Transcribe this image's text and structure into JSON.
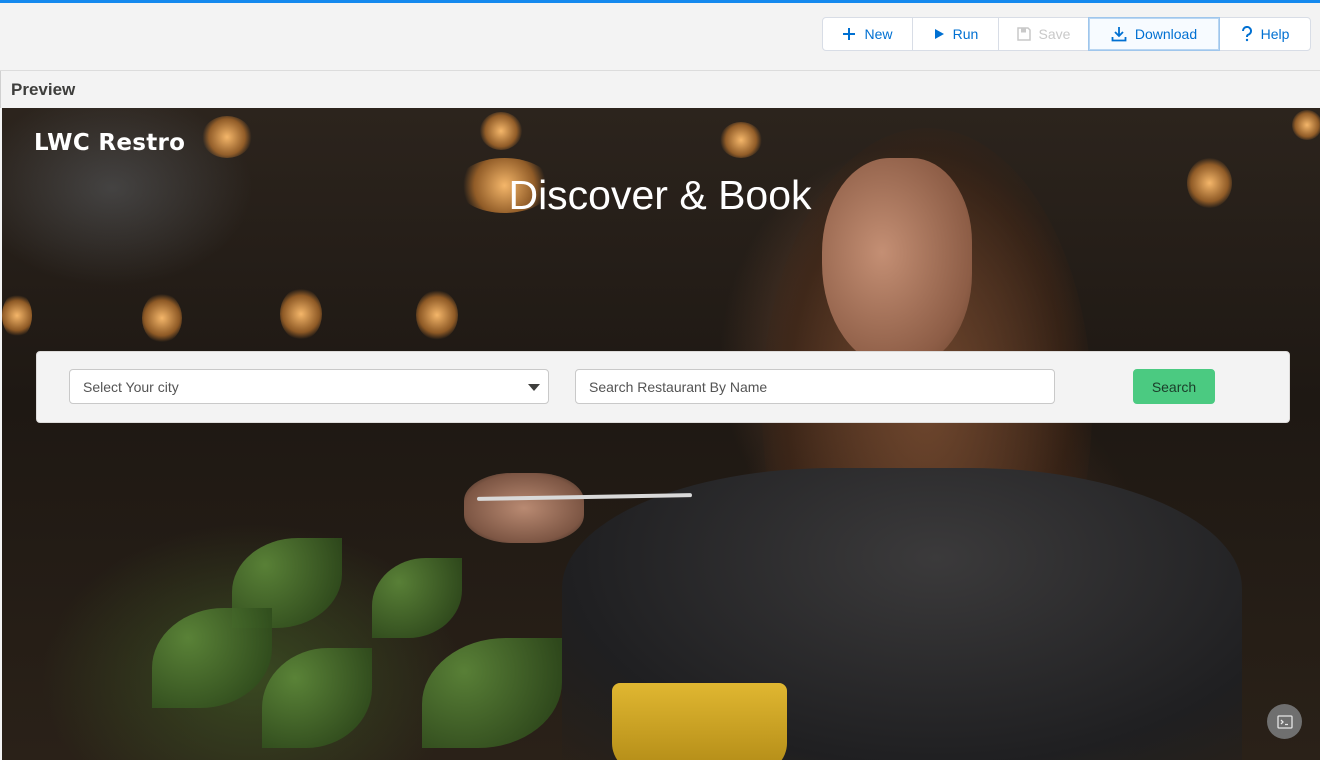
{
  "toolbar": {
    "buttons": [
      {
        "label": "New",
        "icon": "plus-icon"
      },
      {
        "label": "Run",
        "icon": "play-icon"
      },
      {
        "label": "Save",
        "icon": "save-icon",
        "disabled": true
      },
      {
        "label": "Download",
        "icon": "download-icon",
        "active": true
      },
      {
        "label": "Help",
        "icon": "question-icon"
      }
    ],
    "accent_color": "#0070d2"
  },
  "preview": {
    "title": "Preview"
  },
  "app": {
    "brand": "LWC Restro",
    "headline": "Discover & Book",
    "city_select_placeholder": "Select Your city",
    "name_search_placeholder": "Search Restaurant By Name",
    "search_button": "Search",
    "search_button_color": "#4bca81",
    "console_icon": "terminal-icon"
  }
}
